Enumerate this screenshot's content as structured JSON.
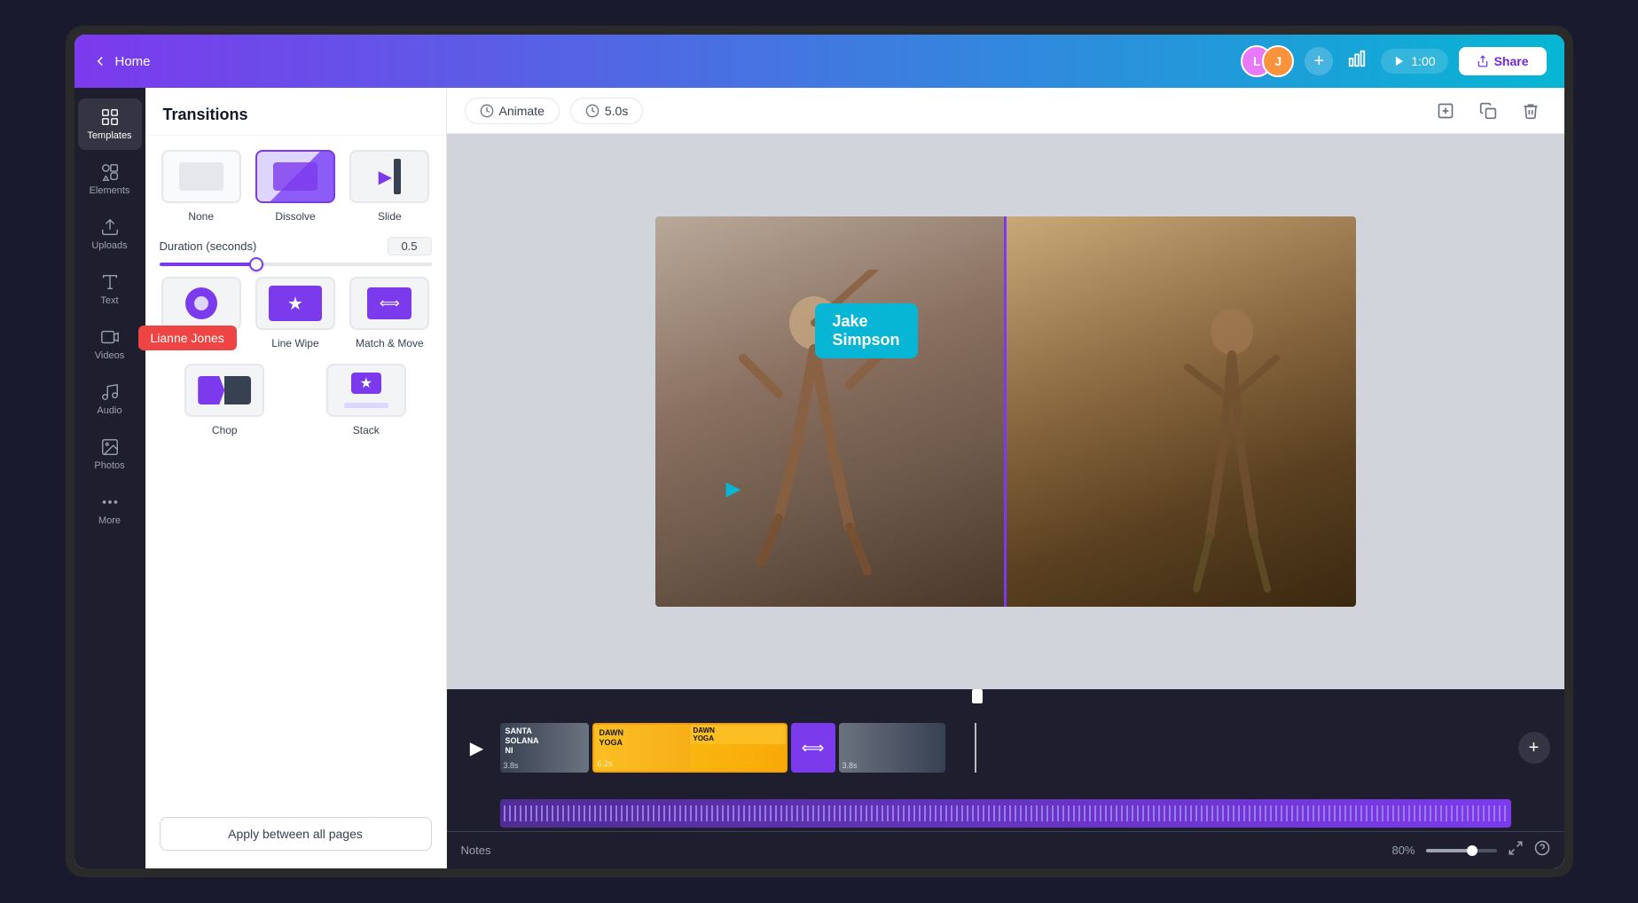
{
  "app": {
    "home_label": "Home",
    "share_label": "Share",
    "play_time": "1:00"
  },
  "sidebar": {
    "items": [
      {
        "label": "Templates",
        "icon": "grid"
      },
      {
        "label": "Elements",
        "icon": "elements"
      },
      {
        "label": "Uploads",
        "icon": "upload"
      },
      {
        "label": "Text",
        "icon": "text"
      },
      {
        "label": "Videos",
        "icon": "video"
      },
      {
        "label": "Audio",
        "icon": "audio"
      },
      {
        "label": "Photos",
        "icon": "photos"
      },
      {
        "label": "More",
        "icon": "more"
      }
    ]
  },
  "panel": {
    "title": "Transitions",
    "duration_label": "Duration (seconds)",
    "duration_value": "0.5",
    "apply_btn": "Apply between all pages",
    "transitions": [
      {
        "id": "none",
        "label": "None",
        "selected": false
      },
      {
        "id": "dissolve",
        "label": "Dissolve",
        "selected": true
      },
      {
        "id": "slide",
        "label": "Slide",
        "selected": false
      },
      {
        "id": "circle_wipe",
        "label": "Circle Wipe",
        "selected": false
      },
      {
        "id": "line_wipe",
        "label": "Line Wipe",
        "selected": false
      },
      {
        "id": "match_move",
        "label": "Match & Move",
        "selected": false
      },
      {
        "id": "chop",
        "label": "Chop",
        "selected": false
      },
      {
        "id": "stack",
        "label": "Stack",
        "selected": false
      }
    ]
  },
  "toolbar": {
    "animate_label": "Animate",
    "time_label": "5.0s"
  },
  "timeline": {
    "play_label": "▶",
    "add_label": "+",
    "clips": [
      {
        "id": "clip1",
        "label": "SANTA SOLANA NI",
        "duration": "3.8s"
      },
      {
        "id": "clip2",
        "label": "DAWN YOGA",
        "duration": "6.2s"
      },
      {
        "id": "clip3",
        "label": "DAWN YOGA",
        "duration": ""
      },
      {
        "id": "clip4",
        "label": "",
        "duration": "3.8s"
      }
    ]
  },
  "bottom_bar": {
    "notes_label": "Notes",
    "zoom_level": "80%"
  },
  "preview": {
    "jake_label": "Jake Simpson",
    "cursor_char": "▶"
  },
  "tooltip": {
    "text": "Lianne Jones"
  }
}
